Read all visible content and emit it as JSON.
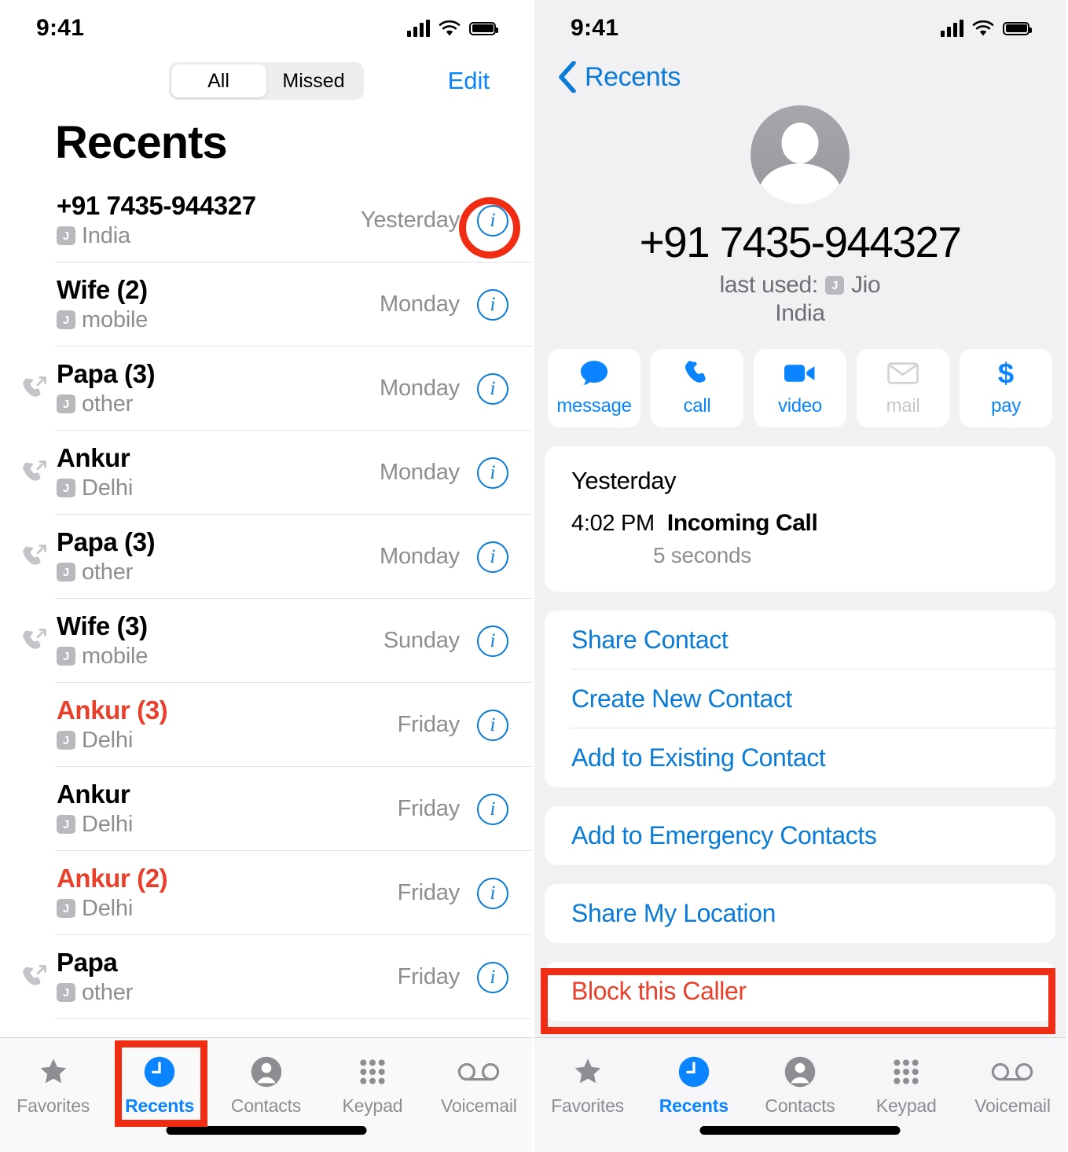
{
  "left": {
    "status": {
      "time": "9:41"
    },
    "segmented": {
      "options": [
        "All",
        "Missed"
      ],
      "selected": "All"
    },
    "edit_label": "Edit",
    "page_title": "Recents",
    "calls": [
      {
        "name": "+91 7435-944327",
        "sim": "J",
        "sub": "India",
        "time": "Yesterday",
        "direction": "none",
        "missed": false
      },
      {
        "name": "Wife (2)",
        "sim": "J",
        "sub": "mobile",
        "time": "Monday",
        "direction": "none",
        "missed": false
      },
      {
        "name": "Papa (3)",
        "sim": "J",
        "sub": "other",
        "time": "Monday",
        "direction": "outgoing",
        "missed": false
      },
      {
        "name": "Ankur",
        "sim": "J",
        "sub": "Delhi",
        "time": "Monday",
        "direction": "outgoing",
        "missed": false
      },
      {
        "name": "Papa (3)",
        "sim": "J",
        "sub": "other",
        "time": "Monday",
        "direction": "outgoing",
        "missed": false
      },
      {
        "name": "Wife (3)",
        "sim": "J",
        "sub": "mobile",
        "time": "Sunday",
        "direction": "outgoing",
        "missed": false
      },
      {
        "name": "Ankur (3)",
        "sim": "J",
        "sub": "Delhi",
        "time": "Friday",
        "direction": "none",
        "missed": true
      },
      {
        "name": "Ankur",
        "sim": "J",
        "sub": "Delhi",
        "time": "Friday",
        "direction": "none",
        "missed": false
      },
      {
        "name": "Ankur (2)",
        "sim": "J",
        "sub": "Delhi",
        "time": "Friday",
        "direction": "none",
        "missed": true
      },
      {
        "name": "Papa",
        "sim": "J",
        "sub": "other",
        "time": "Friday",
        "direction": "outgoing",
        "missed": false
      }
    ],
    "tabs": [
      {
        "label": "Favorites",
        "icon": "star-icon",
        "active": false
      },
      {
        "label": "Recents",
        "icon": "clock-icon",
        "active": true
      },
      {
        "label": "Contacts",
        "icon": "person-icon",
        "active": false
      },
      {
        "label": "Keypad",
        "icon": "keypad-icon",
        "active": false
      },
      {
        "label": "Voicemail",
        "icon": "voicemail-icon",
        "active": false
      }
    ]
  },
  "right": {
    "status": {
      "time": "9:41"
    },
    "back_label": "Recents",
    "contact": {
      "number": "+91 7435-944327",
      "last_used_prefix": "last used:",
      "sim": "J",
      "carrier": "Jio",
      "country": "India"
    },
    "actions": [
      {
        "label": "message",
        "icon": "message-bubble-icon",
        "disabled": false
      },
      {
        "label": "call",
        "icon": "phone-handset-icon",
        "disabled": false
      },
      {
        "label": "video",
        "icon": "video-camera-icon",
        "disabled": false
      },
      {
        "label": "mail",
        "icon": "envelope-icon",
        "disabled": true
      },
      {
        "label": "pay",
        "icon": "dollar-sign-icon",
        "disabled": false
      }
    ],
    "history": {
      "day": "Yesterday",
      "time": "4:02 PM",
      "type": "Incoming Call",
      "duration": "5 seconds"
    },
    "menu_group_1": [
      "Share Contact",
      "Create New Contact",
      "Add to Existing Contact"
    ],
    "menu_group_2": [
      "Add to Emergency Contacts"
    ],
    "menu_group_3": [
      "Share My Location"
    ],
    "menu_group_4": [
      "Block this Caller"
    ],
    "tabs": [
      {
        "label": "Favorites",
        "icon": "star-icon",
        "active": false
      },
      {
        "label": "Recents",
        "icon": "clock-icon",
        "active": true
      },
      {
        "label": "Contacts",
        "icon": "person-icon",
        "active": false
      },
      {
        "label": "Keypad",
        "icon": "keypad-icon",
        "active": false
      },
      {
        "label": "Voicemail",
        "icon": "voicemail-icon",
        "active": false
      }
    ]
  },
  "annotations": {
    "accent_color": "#f02d12",
    "info_button_ring": "highlight-info-button",
    "recents_tab_box": "highlight-recents-tab",
    "block_caller_box": "highlight-block-this-caller"
  }
}
